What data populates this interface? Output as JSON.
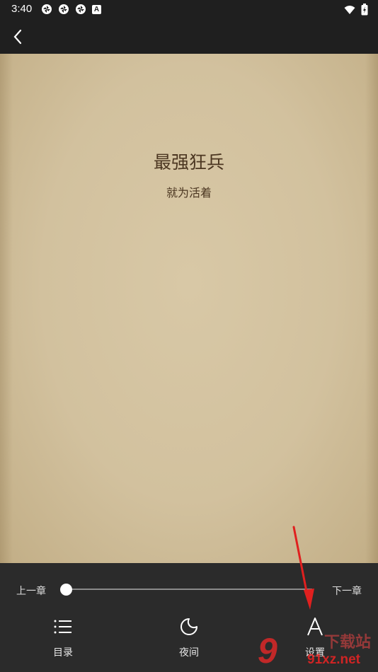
{
  "status_bar": {
    "time": "3:40",
    "badge_letter": "A"
  },
  "icons": {
    "back": "chevron-left-icon",
    "catalog": "list-icon",
    "night": "moon-icon",
    "settings": "font-a-icon"
  },
  "book": {
    "title": "最强狂兵",
    "subtitle": "就为活着"
  },
  "controls": {
    "prev_chapter": "上一章",
    "next_chapter": "下一章",
    "progress": 0.0
  },
  "toolbar": {
    "catalog_label": "目录",
    "night_label": "夜间",
    "settings_label": "设置"
  },
  "watermark": {
    "number": "9",
    "site": "91xz.net",
    "text": "下载站"
  },
  "colors": {
    "page_bg": "#d2c19e",
    "panel_bg": "#2b2b2b",
    "text": "#4b3621",
    "annotation": "#e0201f"
  }
}
